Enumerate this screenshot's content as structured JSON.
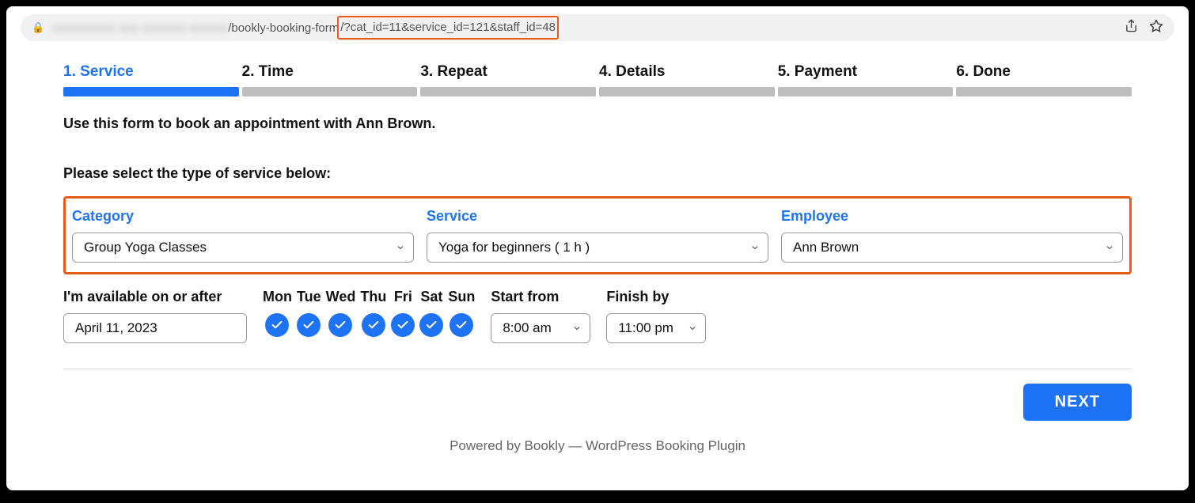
{
  "url": {
    "obscured": "xxxxxxxxxx xxx xxxxxxx xxxxxx",
    "path": "/bookly-booking-form",
    "query": "/?cat_id=11&service_id=121&staff_id=48"
  },
  "steps": [
    {
      "label": "1. Service",
      "active": true
    },
    {
      "label": "2. Time",
      "active": false
    },
    {
      "label": "3. Repeat",
      "active": false
    },
    {
      "label": "4. Details",
      "active": false
    },
    {
      "label": "5. Payment",
      "active": false
    },
    {
      "label": "6. Done",
      "active": false
    }
  ],
  "intro": "Use this form to book an appointment with Ann Brown.",
  "subintro": "Please select the type of service below:",
  "fields": {
    "category": {
      "label": "Category",
      "value": "Group Yoga Classes"
    },
    "service": {
      "label": "Service",
      "value": "Yoga for beginners ( 1 h )"
    },
    "employee": {
      "label": "Employee",
      "value": "Ann Brown"
    }
  },
  "availability": {
    "date_label": "I'm available on or after",
    "date_value": "April 11, 2023",
    "days": [
      "Mon",
      "Tue",
      "Wed",
      "Thu",
      "Fri",
      "Sat",
      "Sun"
    ],
    "start_label": "Start from",
    "start_value": "8:00 am",
    "finish_label": "Finish by",
    "finish_value": "11:00 pm"
  },
  "next_label": "NEXT",
  "powered": "Powered by Bookly — WordPress Booking Plugin",
  "colors": {
    "primary": "#1e73f4",
    "highlight_border": "#e95c17"
  }
}
